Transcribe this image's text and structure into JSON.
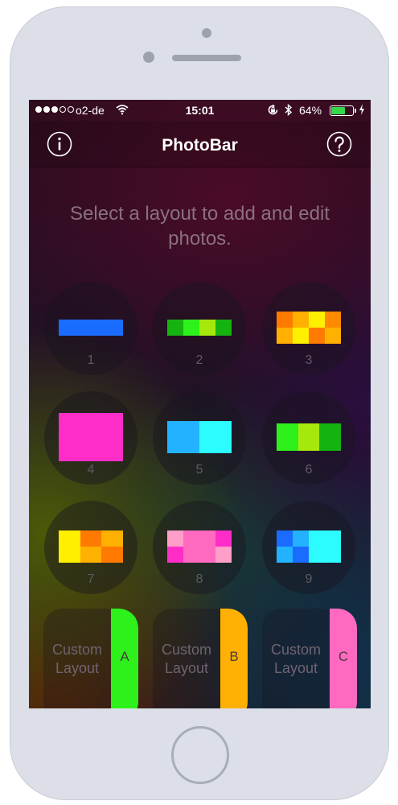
{
  "status_bar": {
    "carrier": "o2-de",
    "time": "15:01",
    "battery_percent": "64%",
    "battery_level": 0.64,
    "signal_bars_filled": 3,
    "signal_bars_total": 5
  },
  "nav": {
    "title": "PhotoBar",
    "info_icon": "info-icon",
    "help_icon": "help-icon"
  },
  "instruction": "Select a layout to add and edit photos.",
  "layouts": [
    {
      "number": "1",
      "colors": [
        [
          "#1a6cff"
        ]
      ]
    },
    {
      "number": "2",
      "colors": [
        [
          "#15b30f",
          "#2ef01a",
          "#a6e80c",
          "#15b30f"
        ]
      ]
    },
    {
      "number": "3",
      "colors": [
        [
          "#ff7a00",
          "#ffb000",
          "#ffef00",
          "#ff8a00"
        ],
        [
          "#ffb000",
          "#ffef00",
          "#ff7a00",
          "#ffb000"
        ]
      ]
    },
    {
      "number": "4",
      "colors": [
        [
          "#ff2dc8"
        ]
      ]
    },
    {
      "number": "5",
      "colors": [
        [
          "#22b2ff",
          "#2cfcff"
        ]
      ]
    },
    {
      "number": "6",
      "colors": [
        [
          "#2ef01a",
          "#a6e80c",
          "#15b30f"
        ]
      ]
    },
    {
      "number": "7",
      "colors": [
        [
          "#ffef00",
          "#ff7a00",
          "#ffb000"
        ],
        [
          "#ffef00",
          "#ffb000",
          "#ff7a00"
        ]
      ]
    },
    {
      "number": "8",
      "colors": [
        [
          "#ff9ec8",
          "#ff6ac0",
          "#ff6ac0",
          "#ff2dc8"
        ],
        [
          "#ff2dc8",
          "#ff6ac0",
          "#ff6ac0",
          "#ff9ec8"
        ]
      ]
    },
    {
      "number": "9",
      "colors": [
        [
          "#1a6cff",
          "#22b2ff",
          "#2cfcff",
          "#2cfcff"
        ],
        [
          "#22b2ff",
          "#1a6cff",
          "#2cfcff",
          "#2cfcff"
        ]
      ]
    }
  ],
  "custom_layouts": [
    {
      "label_line1": "Custom",
      "label_line2": "Layout",
      "letter": "A",
      "color": "#2ef01a"
    },
    {
      "label_line1": "Custom",
      "label_line2": "Layout",
      "letter": "B",
      "color": "#ffb000"
    },
    {
      "label_line1": "Custom",
      "label_line2": "Layout",
      "letter": "C",
      "color": "#ff6ac0"
    }
  ]
}
